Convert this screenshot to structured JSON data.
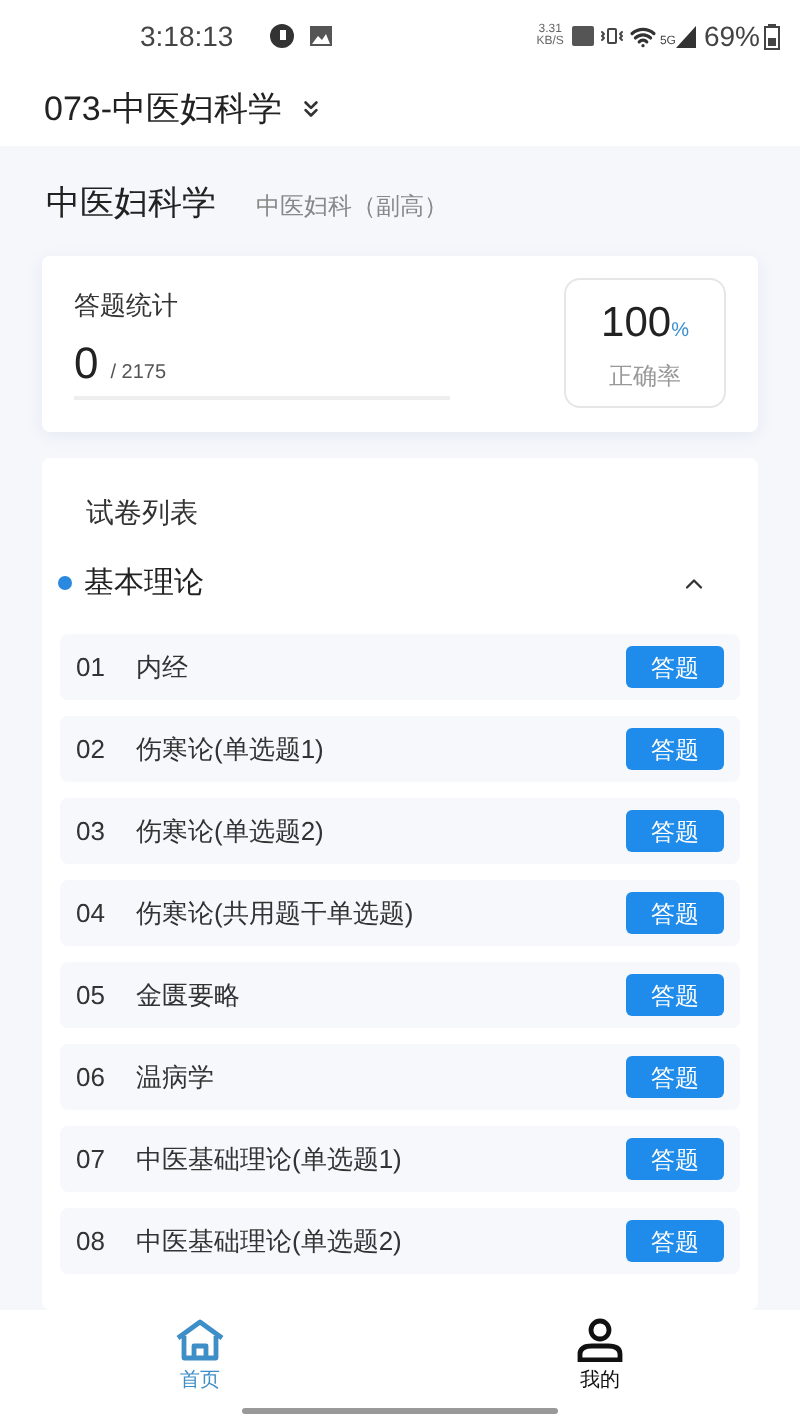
{
  "status_bar": {
    "time": "3:18:13",
    "net_speed": "3.31",
    "net_unit": "KB/S",
    "network": "5G",
    "battery": "69%"
  },
  "header": {
    "title": "073-中医妇科学"
  },
  "subject": {
    "name": "中医妇科学",
    "category": "中医妇科（副高）"
  },
  "stats": {
    "label": "答题统计",
    "answered": "0",
    "total": "/ 2175",
    "accuracy": "100",
    "accuracy_unit": "%",
    "accuracy_label": "正确率"
  },
  "paper_list": {
    "title": "试卷列表",
    "section": {
      "name": "基本理论",
      "expanded": true
    },
    "items": [
      {
        "number": "01",
        "name": "内经",
        "action": "答题"
      },
      {
        "number": "02",
        "name": "伤寒论(单选题1)",
        "action": "答题"
      },
      {
        "number": "03",
        "name": "伤寒论(单选题2)",
        "action": "答题"
      },
      {
        "number": "04",
        "name": "伤寒论(共用题干单选题)",
        "action": "答题"
      },
      {
        "number": "05",
        "name": "金匮要略",
        "action": "答题"
      },
      {
        "number": "06",
        "name": "温病学",
        "action": "答题"
      },
      {
        "number": "07",
        "name": "中医基础理论(单选题1)",
        "action": "答题"
      },
      {
        "number": "08",
        "name": "中医基础理论(单选题2)",
        "action": "答题"
      }
    ]
  },
  "tab_bar": [
    {
      "label": "首页",
      "kind": "home",
      "selected": true
    },
    {
      "label": "我的",
      "kind": "profile",
      "selected": false
    }
  ]
}
